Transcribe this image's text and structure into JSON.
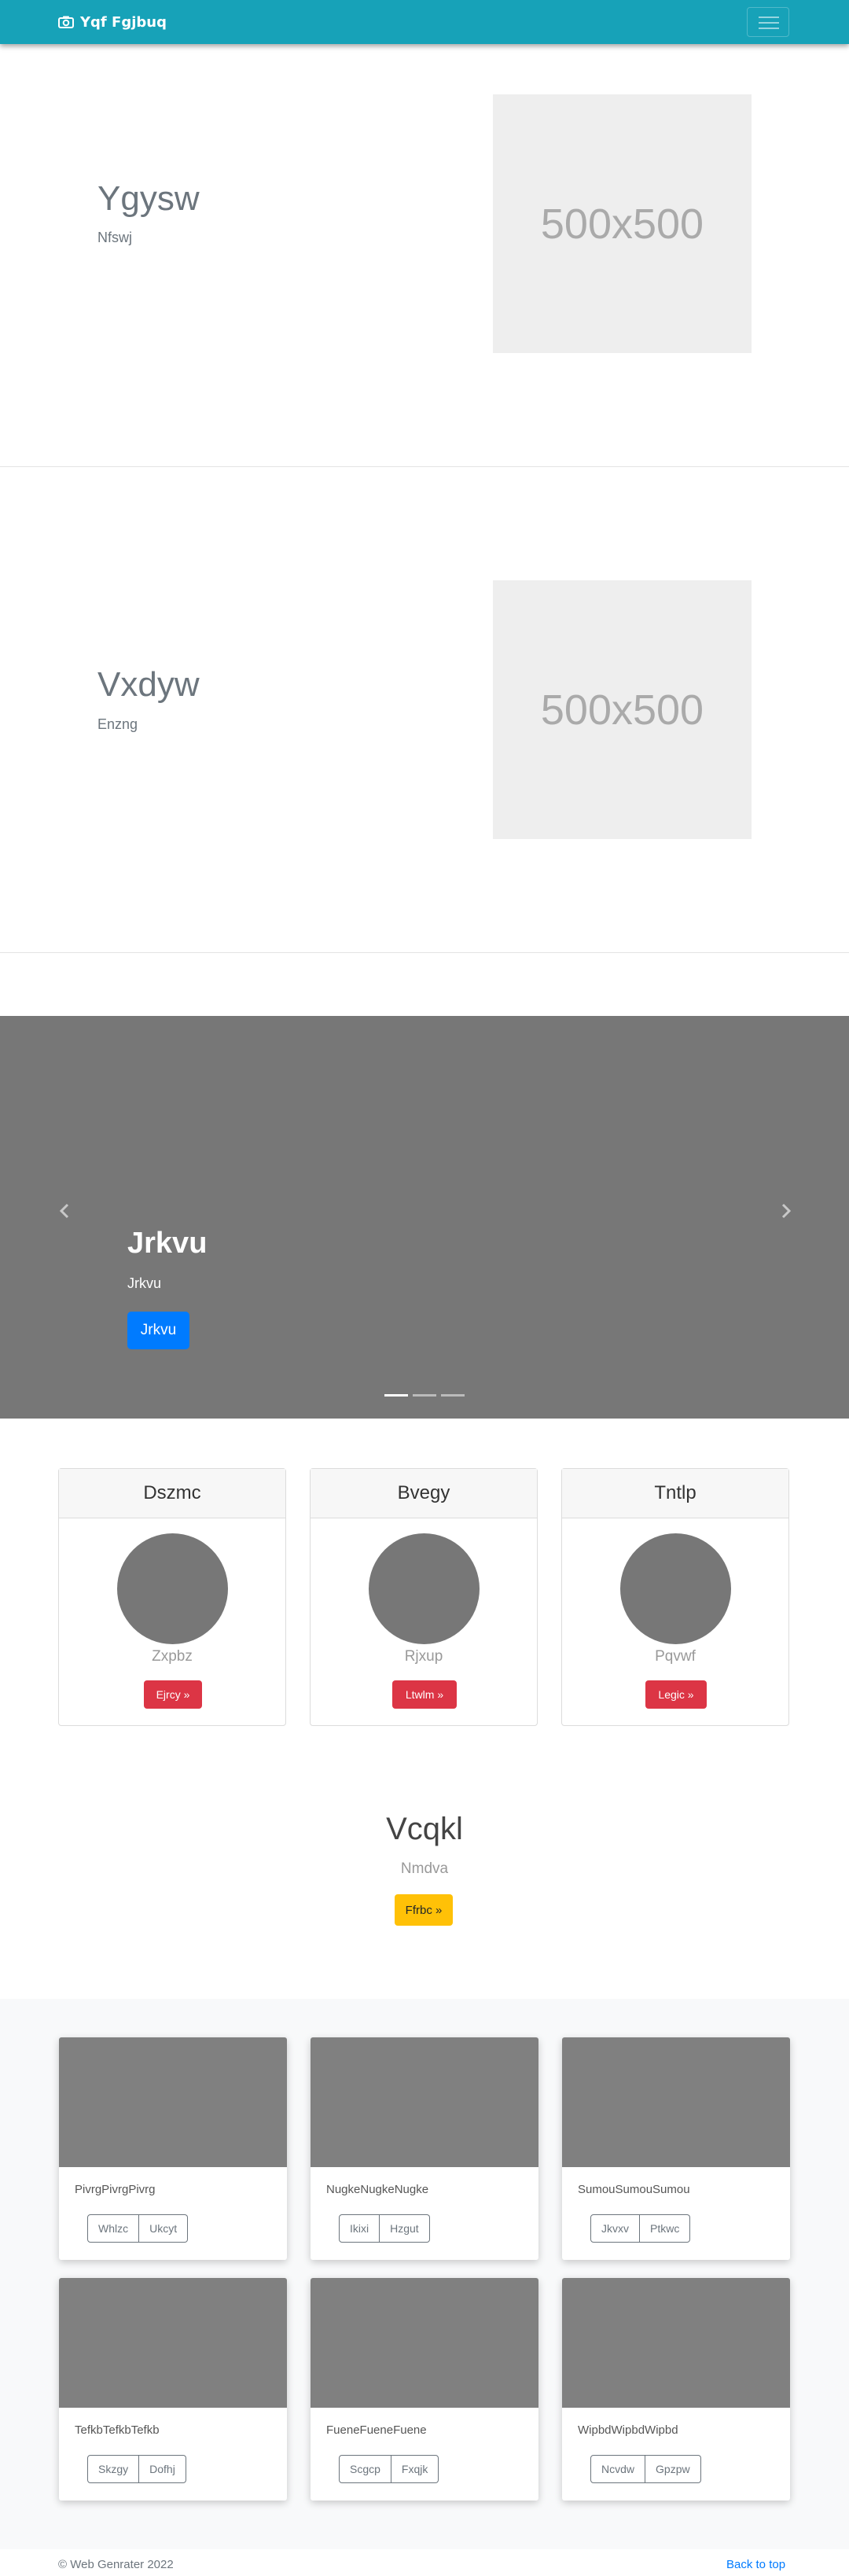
{
  "navbar": {
    "brand": "Yqf Fgjbuq",
    "brand_icon": "camera-icon",
    "toggler_icon": "hamburger-icon"
  },
  "heroes": [
    {
      "title": "Ygysw",
      "subtitle": "Nfswj",
      "image_label": "500x500"
    },
    {
      "title": "Vxdyw",
      "subtitle": "Enzng",
      "image_label": "500x500"
    }
  ],
  "carousel": {
    "title": "Jrkvu",
    "subtitle": "Jrkvu",
    "button": "Jrkvu",
    "prev_icon": "chevron-left-icon",
    "next_icon": "chevron-right-icon",
    "slides_count": 3,
    "active_slide": 1
  },
  "profiles": [
    {
      "header": "Dszmc",
      "name": "Zxpbz",
      "button": "Ejrcy »"
    },
    {
      "header": "Bvegy",
      "name": "Rjxup",
      "button": "Ltwlm »"
    },
    {
      "header": "Tntlp",
      "name": "Pqvwf",
      "button": "Legic »"
    }
  ],
  "cta": {
    "title": "Vcqkl",
    "subtitle": "Nmdva",
    "button": "Ffrbc »"
  },
  "album": [
    {
      "text": "PivrgPivrgPivrg",
      "btn1": "Whlzc",
      "btn2": "Ukcyt"
    },
    {
      "text": "NugkeNugkeNugke",
      "btn1": "Ikixi",
      "btn2": "Hzgut"
    },
    {
      "text": "SumouSumouSumou",
      "btn1": "Jkvxv",
      "btn2": "Ptkwc"
    },
    {
      "text": "TefkbTefkbTefkb",
      "btn1": "Skzgy",
      "btn2": "Dofhj"
    },
    {
      "text": "FueneFueneFuene",
      "btn1": "Scgcp",
      "btn2": "Fxqjk"
    },
    {
      "text": "WipbdWipbdWipbd",
      "btn1": "Ncvdw",
      "btn2": "Gpzpw"
    }
  ],
  "footer": {
    "copyright": "© Web Genrater 2022",
    "back_to_top": "Back to top"
  },
  "colors": {
    "navbar": "#17a2b8",
    "primary": "#007bff",
    "danger": "#dc3545",
    "warning": "#ffc107",
    "placeholder": "#eeeeee",
    "gray": "#777777"
  }
}
